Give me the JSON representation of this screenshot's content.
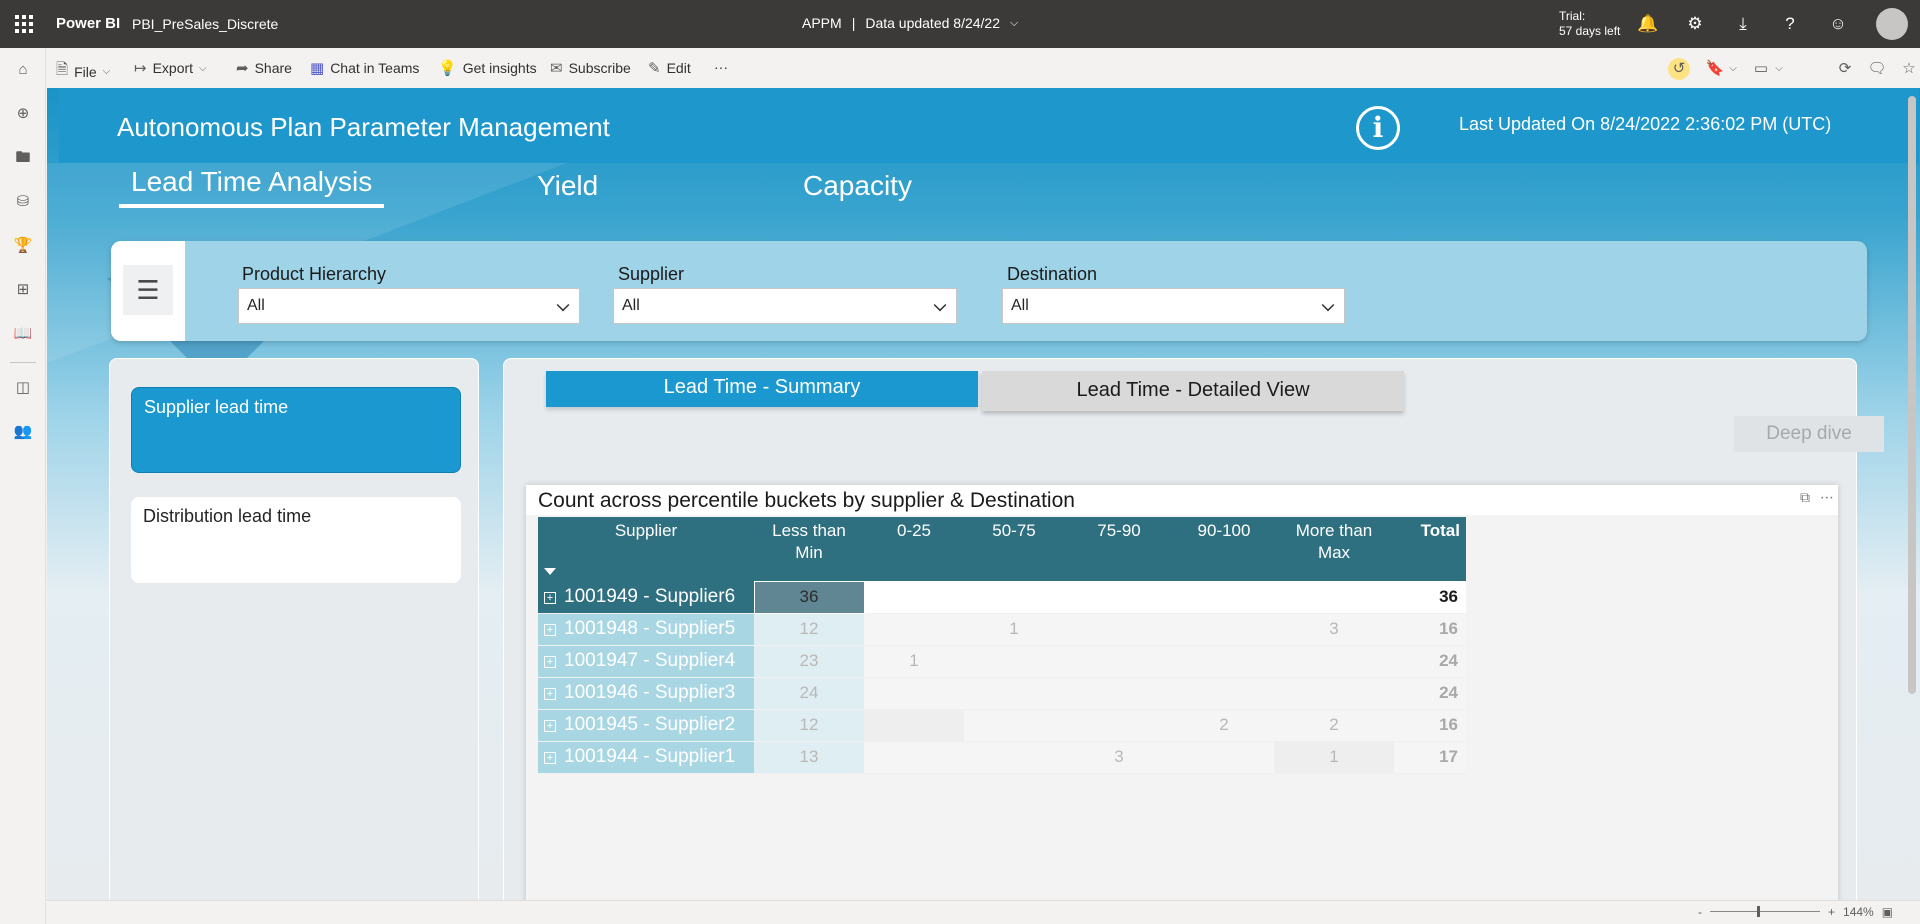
{
  "topbar": {
    "brand": "Power BI",
    "report_name": "PBI_PreSales_Discrete",
    "workspace": "APPM",
    "separator": "|",
    "data_updated": "Data updated 8/24/22",
    "trial_line1": "Trial:",
    "trial_line2": "57 days left"
  },
  "commands": {
    "file": "File",
    "export": "Export",
    "share": "Share",
    "chat_teams": "Chat in Teams",
    "insights": "Get insights",
    "subscribe": "Subscribe",
    "edit": "Edit",
    "more": "···"
  },
  "report": {
    "title": "Autonomous Plan Parameter Management",
    "last_updated": "Last Updated On 8/24/2022 2:36:02 PM (UTC)",
    "info_glyph": "i",
    "nav_tabs": [
      "Lead Time Analysis",
      "Yield",
      "Capacity"
    ],
    "filters": [
      {
        "label": "Product Hierarchy",
        "value": "All"
      },
      {
        "label": "Supplier",
        "value": "All"
      },
      {
        "label": "Destination",
        "value": "All"
      }
    ],
    "side_buttons": [
      "Supplier lead time",
      "Distribution lead time"
    ],
    "sub_tabs": [
      "Lead Time - Summary",
      "Lead Time - Detailed View"
    ],
    "deep_dive": "Deep dive"
  },
  "chart_data": {
    "type": "table",
    "title": "Count across percentile buckets by supplier & Destination",
    "columns": [
      "Supplier",
      "Less than Min",
      "0-25",
      "50-75",
      "75-90",
      "90-100",
      "More than Max",
      "Total"
    ],
    "column_lines": [
      [
        "Supplier"
      ],
      [
        "Less than",
        "Min"
      ],
      [
        "0-25"
      ],
      [
        "50-75"
      ],
      [
        "75-90"
      ],
      [
        "90-100"
      ],
      [
        "More than",
        "Max"
      ],
      [
        "Total"
      ]
    ],
    "rows": [
      {
        "supplier": "1001949 - Supplier6",
        "values": [
          "36",
          "",
          "",
          "",
          "",
          "",
          "36"
        ]
      },
      {
        "supplier": "1001948 - Supplier5",
        "values": [
          "12",
          "",
          "1",
          "",
          "",
          "3",
          "16"
        ]
      },
      {
        "supplier": "1001947 - Supplier4",
        "values": [
          "23",
          "1",
          "",
          "",
          "",
          "",
          "24"
        ]
      },
      {
        "supplier": "1001946 - Supplier3",
        "values": [
          "24",
          "",
          "",
          "",
          "",
          "",
          "24"
        ]
      },
      {
        "supplier": "1001945 - Supplier2",
        "values": [
          "12",
          "",
          "",
          "",
          "2",
          "2",
          "16"
        ]
      },
      {
        "supplier": "1001944 - Supplier1",
        "values": [
          "13",
          "",
          "",
          "3",
          "",
          "1",
          "17"
        ]
      }
    ],
    "selected_row": 0
  },
  "status": {
    "zoom_minus": "-",
    "zoom_plus": "+",
    "zoom": "144%",
    "zoom_level": 0.44
  },
  "colors": {
    "header_bg": "#3b3a39",
    "accent": "#1a98cf",
    "matrix_header": "#2e6f80"
  }
}
